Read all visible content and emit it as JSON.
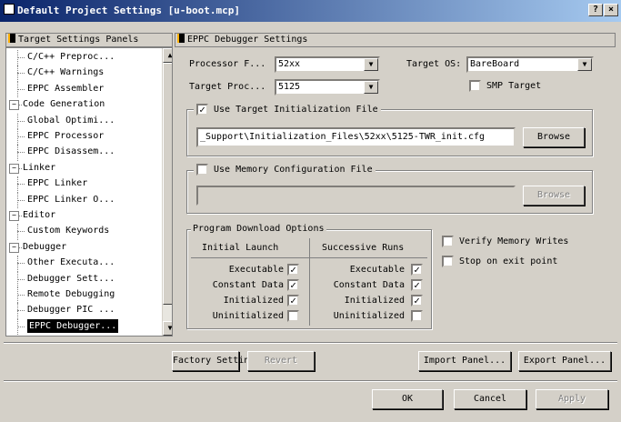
{
  "window": {
    "title": "Default Project Settings [u-boot.mcp]",
    "help": "?",
    "close": "×"
  },
  "left_panel": {
    "header": "Target Settings Panels",
    "items": [
      {
        "label": "C/C++ Preproc...",
        "level": 1
      },
      {
        "label": "C/C++ Warnings",
        "level": 1
      },
      {
        "label": "EPPC Assembler",
        "level": 1
      },
      {
        "label": "Code Generation",
        "level": 0,
        "expander": "−"
      },
      {
        "label": "Global Optimi...",
        "level": 1
      },
      {
        "label": "EPPC Processor",
        "level": 1
      },
      {
        "label": "EPPC Disassem...",
        "level": 1
      },
      {
        "label": "Linker",
        "level": 0,
        "expander": "−"
      },
      {
        "label": "EPPC Linker",
        "level": 1
      },
      {
        "label": "EPPC Linker O...",
        "level": 1
      },
      {
        "label": "Editor",
        "level": 0,
        "expander": "−"
      },
      {
        "label": "Custom Keywords",
        "level": 1
      },
      {
        "label": "Debugger",
        "level": 0,
        "expander": "−"
      },
      {
        "label": "Other Executa...",
        "level": 1
      },
      {
        "label": "Debugger Sett...",
        "level": 1
      },
      {
        "label": "Remote Debugging",
        "level": 1
      },
      {
        "label": "Debugger PIC ...",
        "level": 1
      },
      {
        "label": "EPPC Debugger...",
        "level": 1,
        "selected": true
      }
    ]
  },
  "right_panel": {
    "header": "EPPC Debugger Settings",
    "processor_family_label": "Processor F...",
    "processor_family_value": "52xx",
    "target_os_label": "Target OS:",
    "target_os_value": "BareBoard",
    "target_processor_label": "Target Proc...",
    "target_processor_value": "5125",
    "smp_target_label": "SMP Target",
    "use_init_file_label": "Use Target Initialization File",
    "init_file_path": "_Support\\Initialization_Files\\52xx\\5125-TWR_init.cfg",
    "browse_label": "Browse",
    "use_memory_config_label": "Use Memory Configuration File",
    "memory_config_path": "",
    "browse_disabled_label": "Browse",
    "download_group_label": "Program Download Options",
    "col_initial": "Initial Launch",
    "col_successive": "Successive Runs",
    "rows": [
      {
        "label": "Executable",
        "initial": true,
        "successive": true
      },
      {
        "label": "Constant Data",
        "initial": true,
        "successive": true
      },
      {
        "label": "Initialized",
        "initial": true,
        "successive": true
      },
      {
        "label": "Uninitialized",
        "initial": false,
        "successive": false
      }
    ],
    "verify_memory_label": "Verify Memory Writes",
    "stop_on_exit_label": "Stop on exit point"
  },
  "bottom_bar": {
    "factory_label": "Factory Settings",
    "revert_label": "Revert",
    "import_label": "Import Panel...",
    "export_label": "Export Panel..."
  },
  "footer": {
    "ok_label": "OK",
    "cancel_label": "Cancel",
    "apply_label": "Apply"
  }
}
